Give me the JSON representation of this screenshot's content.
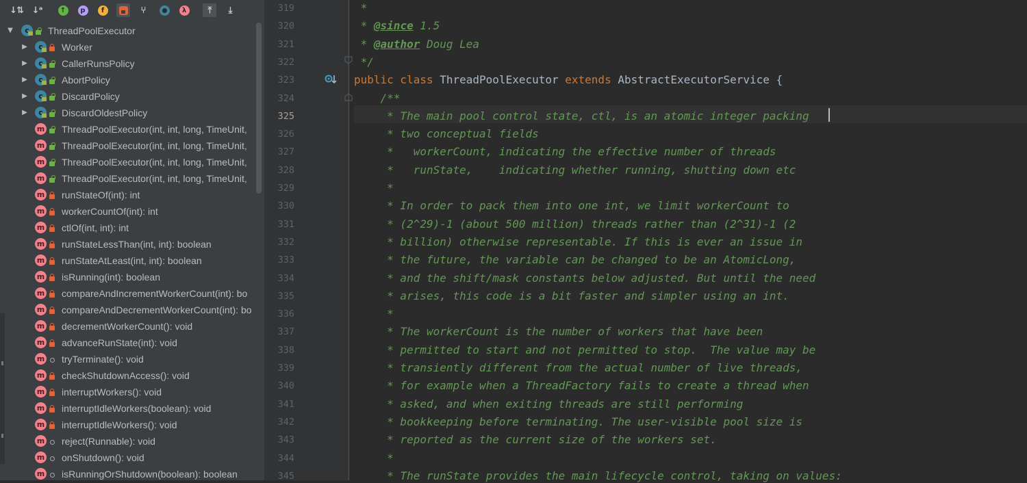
{
  "structure": {
    "toolbar": [
      {
        "name": "sort-by-visibility-icon",
        "glyph": "↓⇅",
        "color": "#c8c8c8"
      },
      {
        "name": "sort-alphabetically-icon",
        "glyph": "↓ᵃ",
        "color": "#c8c8c8"
      },
      {
        "name": "show-inherited-icon",
        "glyph": "↑",
        "color": "#62b543"
      },
      {
        "name": "show-properties-icon",
        "glyph": "p",
        "color": "#b99bf8"
      },
      {
        "name": "show-fields-icon",
        "glyph": "f",
        "color": "#f4af3d"
      },
      {
        "name": "show-non-public-icon",
        "glyph": "🔒",
        "color": "#e0643a"
      },
      {
        "name": "show-hierarchy-icon",
        "glyph": "⑂",
        "color": "#c8c8c8"
      },
      {
        "name": "show-anonymous-classes-icon",
        "glyph": "◉",
        "color": "#3e86a0"
      },
      {
        "name": "show-lambdas-icon",
        "glyph": "λ",
        "color": "#f1828d"
      },
      {
        "name": "autoscroll-to-source-icon",
        "glyph": "⤒",
        "color": "#c8c8c8"
      },
      {
        "name": "autoscroll-from-source-icon",
        "glyph": "⤓",
        "color": "#c8c8c8"
      }
    ],
    "tree": [
      {
        "kind": "class",
        "depth": 0,
        "expanded": true,
        "label": "ThreadPoolExecutor",
        "vis": "public"
      },
      {
        "kind": "class",
        "depth": 1,
        "expanded": false,
        "label": "Worker",
        "vis": "private"
      },
      {
        "kind": "class",
        "depth": 1,
        "expanded": false,
        "label": "CallerRunsPolicy",
        "vis": "public"
      },
      {
        "kind": "class",
        "depth": 1,
        "expanded": false,
        "label": "AbortPolicy",
        "vis": "public"
      },
      {
        "kind": "class",
        "depth": 1,
        "expanded": false,
        "label": "DiscardPolicy",
        "vis": "public"
      },
      {
        "kind": "class",
        "depth": 1,
        "expanded": false,
        "label": "DiscardOldestPolicy",
        "vis": "public"
      },
      {
        "kind": "method",
        "depth": 1,
        "label": "ThreadPoolExecutor(int, int, long, TimeUnit,",
        "vis": "public"
      },
      {
        "kind": "method",
        "depth": 1,
        "label": "ThreadPoolExecutor(int, int, long, TimeUnit,",
        "vis": "public"
      },
      {
        "kind": "method",
        "depth": 1,
        "label": "ThreadPoolExecutor(int, int, long, TimeUnit,",
        "vis": "public"
      },
      {
        "kind": "method",
        "depth": 1,
        "label": "ThreadPoolExecutor(int, int, long, TimeUnit,",
        "vis": "public"
      },
      {
        "kind": "method",
        "depth": 1,
        "label": "runStateOf(int): int",
        "vis": "private"
      },
      {
        "kind": "method",
        "depth": 1,
        "label": "workerCountOf(int): int",
        "vis": "private"
      },
      {
        "kind": "method",
        "depth": 1,
        "label": "ctlOf(int, int): int",
        "vis": "private"
      },
      {
        "kind": "method",
        "depth": 1,
        "label": "runStateLessThan(int, int): boolean",
        "vis": "private"
      },
      {
        "kind": "method",
        "depth": 1,
        "label": "runStateAtLeast(int, int): boolean",
        "vis": "private"
      },
      {
        "kind": "method",
        "depth": 1,
        "label": "isRunning(int): boolean",
        "vis": "private"
      },
      {
        "kind": "method",
        "depth": 1,
        "label": "compareAndIncrementWorkerCount(int): bo",
        "vis": "private"
      },
      {
        "kind": "method",
        "depth": 1,
        "label": "compareAndDecrementWorkerCount(int): bo",
        "vis": "private"
      },
      {
        "kind": "method",
        "depth": 1,
        "label": "decrementWorkerCount(): void",
        "vis": "private"
      },
      {
        "kind": "method",
        "depth": 1,
        "label": "advanceRunState(int): void",
        "vis": "private"
      },
      {
        "kind": "method",
        "depth": 1,
        "label": "tryTerminate(): void",
        "vis": "package"
      },
      {
        "kind": "method",
        "depth": 1,
        "label": "checkShutdownAccess(): void",
        "vis": "private"
      },
      {
        "kind": "method",
        "depth": 1,
        "label": "interruptWorkers(): void",
        "vis": "private"
      },
      {
        "kind": "method",
        "depth": 1,
        "label": "interruptIdleWorkers(boolean): void",
        "vis": "private"
      },
      {
        "kind": "method",
        "depth": 1,
        "label": "interruptIdleWorkers(): void",
        "vis": "private"
      },
      {
        "kind": "method",
        "depth": 1,
        "label": "reject(Runnable): void",
        "vis": "package"
      },
      {
        "kind": "method",
        "depth": 1,
        "label": "onShutdown(): void",
        "vis": "package"
      },
      {
        "kind": "method",
        "depth": 1,
        "label": "isRunningOrShutdown(boolean): boolean",
        "vis": "package"
      }
    ]
  },
  "editor": {
    "current_line": 325,
    "lines": [
      {
        "n": "319",
        "segs": [
          {
            "c": "doc",
            "t": " *"
          }
        ]
      },
      {
        "n": "320",
        "segs": [
          {
            "c": "doc",
            "t": " * "
          },
          {
            "c": "tag",
            "t": "@since"
          },
          {
            "c": "doc",
            "t": " 1.5"
          }
        ]
      },
      {
        "n": "321",
        "segs": [
          {
            "c": "doc",
            "t": " * "
          },
          {
            "c": "tag",
            "t": "@author"
          },
          {
            "c": "doc",
            "t": " Doug Lea"
          }
        ]
      },
      {
        "n": "322",
        "segs": [
          {
            "c": "doc",
            "t": " */"
          }
        ]
      },
      {
        "n": "323",
        "segs": [
          {
            "c": "kw",
            "t": "public class "
          },
          {
            "c": "id",
            "t": "ThreadPoolExecutor "
          },
          {
            "c": "kw",
            "t": "extends "
          },
          {
            "c": "id",
            "t": "AbstractExecutorService {"
          }
        ]
      },
      {
        "n": "324",
        "segs": [
          {
            "c": "doc",
            "t": "    /**"
          }
        ]
      },
      {
        "n": "325",
        "segs": [
          {
            "c": "doc",
            "t": "     * The main pool control state, ctl, is an atomic integer packing"
          }
        ]
      },
      {
        "n": "326",
        "segs": [
          {
            "c": "doc",
            "t": "     * two conceptual fields"
          }
        ]
      },
      {
        "n": "327",
        "segs": [
          {
            "c": "doc",
            "t": "     *   workerCount, indicating the effective number of threads"
          }
        ]
      },
      {
        "n": "328",
        "segs": [
          {
            "c": "doc",
            "t": "     *   runState,    indicating whether running, shutting down etc"
          }
        ]
      },
      {
        "n": "329",
        "segs": [
          {
            "c": "doc",
            "t": "     *"
          }
        ]
      },
      {
        "n": "330",
        "segs": [
          {
            "c": "doc",
            "t": "     * In order to pack them into one int, we limit workerCount to"
          }
        ]
      },
      {
        "n": "331",
        "segs": [
          {
            "c": "doc",
            "t": "     * (2^29)-1 (about 500 million) threads rather than (2^31)-1 (2"
          }
        ]
      },
      {
        "n": "332",
        "segs": [
          {
            "c": "doc",
            "t": "     * billion) otherwise representable. If this is ever an issue in"
          }
        ]
      },
      {
        "n": "333",
        "segs": [
          {
            "c": "doc",
            "t": "     * the future, the variable can be changed to be an AtomicLong,"
          }
        ]
      },
      {
        "n": "334",
        "segs": [
          {
            "c": "doc",
            "t": "     * and the shift/mask constants below adjusted. But until the need"
          }
        ]
      },
      {
        "n": "335",
        "segs": [
          {
            "c": "doc",
            "t": "     * arises, this code is a bit faster and simpler using an int."
          }
        ]
      },
      {
        "n": "336",
        "segs": [
          {
            "c": "doc",
            "t": "     *"
          }
        ]
      },
      {
        "n": "337",
        "segs": [
          {
            "c": "doc",
            "t": "     * The workerCount is the number of workers that have been"
          }
        ]
      },
      {
        "n": "338",
        "segs": [
          {
            "c": "doc",
            "t": "     * permitted to start and not permitted to stop.  The value may be"
          }
        ]
      },
      {
        "n": "339",
        "segs": [
          {
            "c": "doc",
            "t": "     * transiently different from the actual number of live threads,"
          }
        ]
      },
      {
        "n": "340",
        "segs": [
          {
            "c": "doc",
            "t": "     * for example when a ThreadFactory fails to create a thread when"
          }
        ]
      },
      {
        "n": "341",
        "segs": [
          {
            "c": "doc",
            "t": "     * asked, and when exiting threads are still performing"
          }
        ]
      },
      {
        "n": "342",
        "segs": [
          {
            "c": "doc",
            "t": "     * bookkeeping before terminating. The user-visible pool size is"
          }
        ]
      },
      {
        "n": "343",
        "segs": [
          {
            "c": "doc",
            "t": "     * reported as the current size of the workers set."
          }
        ]
      },
      {
        "n": "344",
        "segs": [
          {
            "c": "doc",
            "t": "     *"
          }
        ]
      },
      {
        "n": "345",
        "segs": [
          {
            "c": "doc",
            "t": "     * The runState provides the main lifecycle control, taking on values:"
          }
        ]
      }
    ]
  }
}
